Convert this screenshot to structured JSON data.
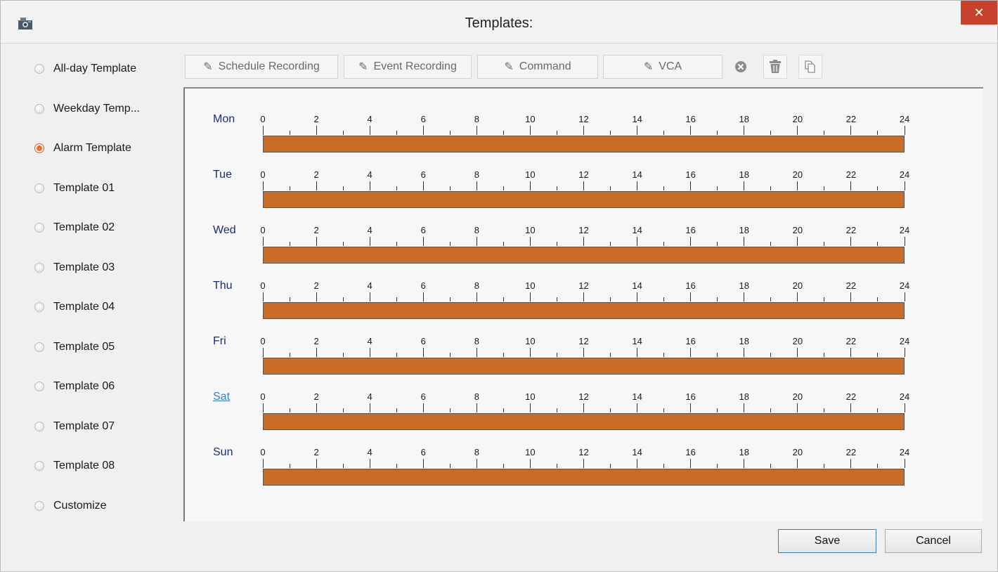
{
  "window": {
    "title": "Templates:",
    "close_glyph": "✕",
    "app_icon": "camera-app-icon"
  },
  "templates": [
    {
      "label": "All-day Template",
      "selected": false
    },
    {
      "label": "Weekday Temp...",
      "selected": false
    },
    {
      "label": "Alarm Template",
      "selected": true
    },
    {
      "label": "Template 01",
      "selected": false
    },
    {
      "label": "Template 02",
      "selected": false
    },
    {
      "label": "Template 03",
      "selected": false
    },
    {
      "label": "Template 04",
      "selected": false
    },
    {
      "label": "Template 05",
      "selected": false
    },
    {
      "label": "Template 06",
      "selected": false
    },
    {
      "label": "Template 07",
      "selected": false
    },
    {
      "label": "Template 08",
      "selected": false
    },
    {
      "label": "Customize",
      "selected": false
    }
  ],
  "toolbar": {
    "schedule_recording": "Schedule Recording",
    "event_recording": "Event Recording",
    "command": "Command",
    "vca": "VCA",
    "pen_glyph": "✎",
    "icons": [
      "delete-icon",
      "trash-icon",
      "copy-icon"
    ]
  },
  "schedule": {
    "tick_labels": [
      "0",
      "2",
      "4",
      "6",
      "8",
      "10",
      "12",
      "14",
      "16",
      "18",
      "20",
      "22",
      "24"
    ],
    "bar_color": "#c86c27",
    "days": [
      {
        "label": "Mon",
        "start": 0,
        "end": 24
      },
      {
        "label": "Tue",
        "start": 0,
        "end": 24
      },
      {
        "label": "Wed",
        "start": 0,
        "end": 24
      },
      {
        "label": "Thu",
        "start": 0,
        "end": 24
      },
      {
        "label": "Fri",
        "start": 0,
        "end": 24
      },
      {
        "label": "Sat",
        "start": 0,
        "end": 24,
        "link": true
      },
      {
        "label": "Sun",
        "start": 0,
        "end": 24
      }
    ]
  },
  "buttons": {
    "save": "Save",
    "cancel": "Cancel"
  },
  "colors": {
    "accent": "#f26a2a",
    "close_bg": "#c7412c",
    "day_label": "#1d2b7a",
    "link": "#3b7cc6"
  }
}
